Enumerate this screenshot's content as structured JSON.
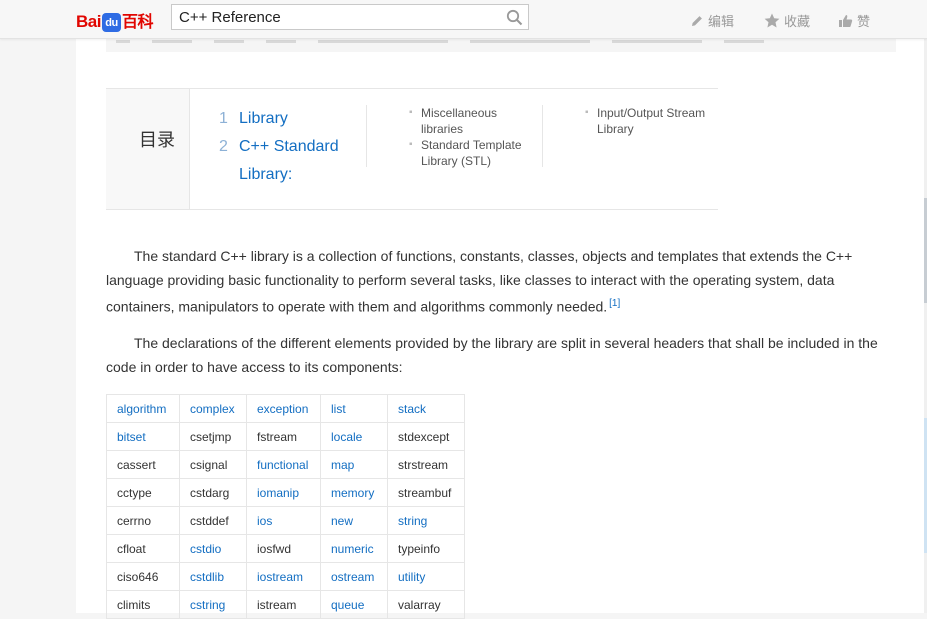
{
  "header": {
    "logo": {
      "bai": "Bai",
      "du": "du",
      "ke": "百科"
    },
    "search": {
      "value": "C++ Reference",
      "placeholder": ""
    },
    "actions": {
      "edit": "编辑",
      "favorite": "收藏",
      "like": "赞"
    }
  },
  "toc": {
    "title": "目录",
    "level1": [
      {
        "num": "1",
        "label": "Library"
      },
      {
        "num": "2",
        "label": "C++ Standard"
      },
      {
        "num": "",
        "label": "Library:"
      }
    ],
    "level2_col1": [
      {
        "line1": "Miscellaneous",
        "line2": "libraries"
      },
      {
        "line1": "Standard Template",
        "line2": "Library (STL)"
      }
    ],
    "level2_col2": [
      {
        "line1": "Input/Output Stream",
        "line2": "Library"
      }
    ]
  },
  "paragraphs": {
    "p1": "The standard C++ library is a collection of functions, constants, classes, objects and templates that extends the C++ language providing basic functionality to perform several tasks, like classes to interact with the operating system, data containers, manipulators to operate with them and algorithms commonly needed.",
    "p1_ref": "[1]",
    "p2": "The declarations of the different elements provided by the library are split in several headers that shall be included in the code in order to have access to its components:"
  },
  "headers_table": {
    "rows": [
      [
        "algorithm",
        "complex",
        "exception",
        "list",
        "stack"
      ],
      [
        "bitset",
        "csetjmp",
        "fstream",
        "locale",
        "stdexcept"
      ],
      [
        "cassert",
        "csignal",
        "functional",
        "map",
        "strstream"
      ],
      [
        "cctype",
        "cstdarg",
        "iomanip",
        "memory",
        "streambuf"
      ],
      [
        "cerrno",
        "cstddef",
        "ios",
        "new",
        "string"
      ],
      [
        "cfloat",
        "cstdio",
        "iosfwd",
        "numeric",
        "typeinfo"
      ],
      [
        "ciso646",
        "cstdlib",
        "iostream",
        "ostream",
        "utility"
      ],
      [
        "climits",
        "cstring",
        "istream",
        "queue",
        "valarray"
      ]
    ],
    "links": [
      [
        true,
        true,
        true,
        true,
        true
      ],
      [
        true,
        false,
        false,
        true,
        false
      ],
      [
        false,
        false,
        true,
        true,
        false
      ],
      [
        false,
        false,
        true,
        true,
        false
      ],
      [
        false,
        false,
        true,
        true,
        true
      ],
      [
        false,
        true,
        false,
        true,
        false
      ],
      [
        false,
        true,
        true,
        true,
        true
      ],
      [
        false,
        true,
        false,
        true,
        false
      ]
    ]
  },
  "colors": {
    "link": "#136ec2",
    "brand_red": "#e10601",
    "brand_blue": "#2f6ce4"
  },
  "icons": {
    "search": "search-icon",
    "edit": "pencil-icon",
    "favorite": "star-icon",
    "like": "thumbs-up-icon"
  }
}
